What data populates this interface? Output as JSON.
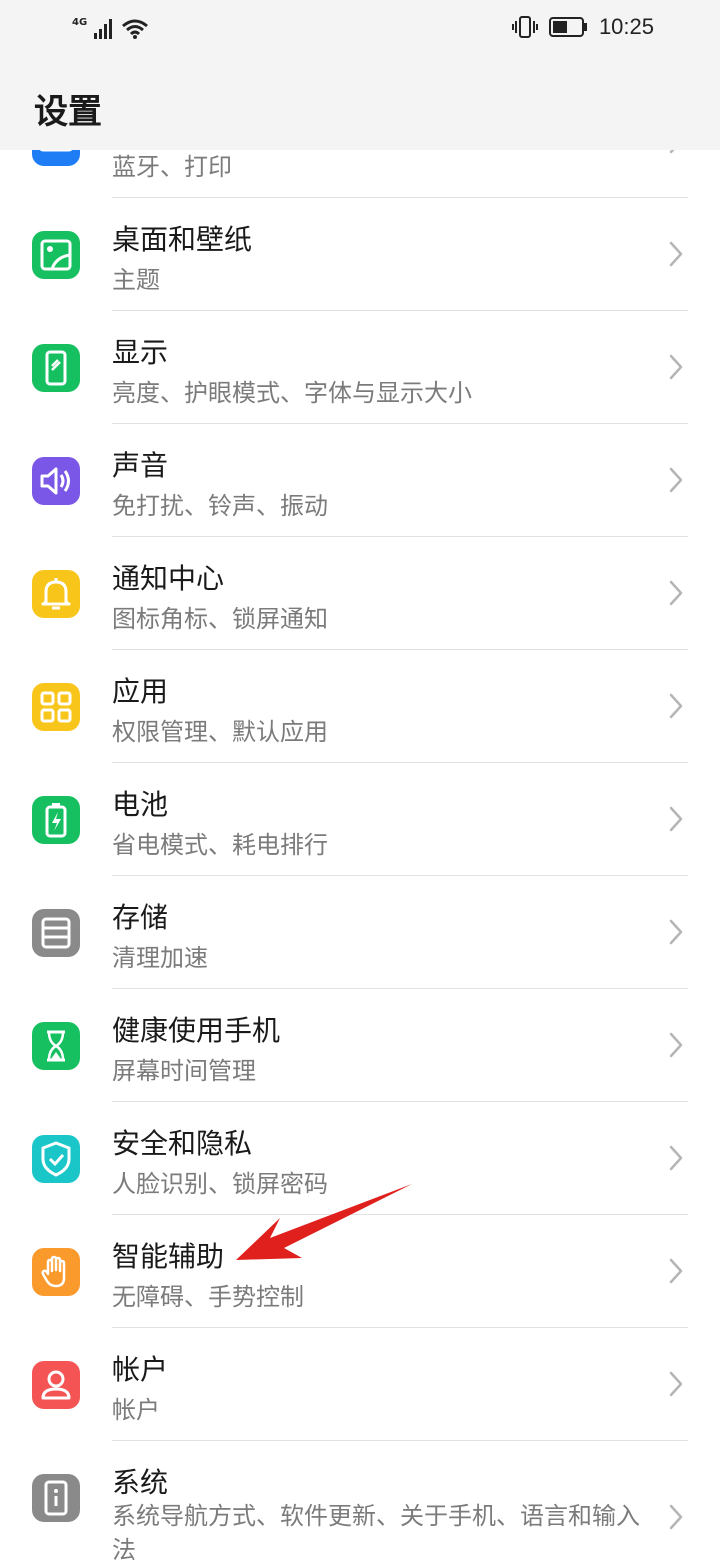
{
  "status_bar": {
    "network": "4G",
    "time": "10:25"
  },
  "header": {
    "title": "设置"
  },
  "items": [
    {
      "title": "",
      "subtitle": "蓝牙、打印",
      "icon": "device-connection-icon",
      "color": "#1e7cf5"
    },
    {
      "title": "桌面和壁纸",
      "subtitle": "主题",
      "icon": "wallpaper-icon",
      "color": "#16c060"
    },
    {
      "title": "显示",
      "subtitle": "亮度、护眼模式、字体与显示大小",
      "icon": "display-icon",
      "color": "#16c060"
    },
    {
      "title": "声音",
      "subtitle": "免打扰、铃声、振动",
      "icon": "sound-icon",
      "color": "#7a57e6"
    },
    {
      "title": "通知中心",
      "subtitle": "图标角标、锁屏通知",
      "icon": "bell-icon",
      "color": "#f8c61b"
    },
    {
      "title": "应用",
      "subtitle": "权限管理、默认应用",
      "icon": "apps-icon",
      "color": "#f8c61b"
    },
    {
      "title": "电池",
      "subtitle": "省电模式、耗电排行",
      "icon": "battery-icon",
      "color": "#16c060"
    },
    {
      "title": "存储",
      "subtitle": "清理加速",
      "icon": "storage-icon",
      "color": "#8a8a8a"
    },
    {
      "title": "健康使用手机",
      "subtitle": "屏幕时间管理",
      "icon": "hourglass-icon",
      "color": "#16c060"
    },
    {
      "title": "安全和隐私",
      "subtitle": "人脸识别、锁屏密码",
      "icon": "shield-check-icon",
      "color": "#1bc6c8"
    },
    {
      "title": "智能辅助",
      "subtitle": "无障碍、手势控制",
      "icon": "hand-icon",
      "color": "#fa9a2c"
    },
    {
      "title": "帐户",
      "subtitle": "帐户",
      "icon": "account-icon",
      "color": "#f55454"
    },
    {
      "title": "系统",
      "subtitle": "系统导航方式、软件更新、关于手机、语言和输入法",
      "icon": "system-info-icon",
      "color": "#8a8a8a"
    }
  ],
  "annotation": {
    "color": "#e0201d",
    "target_item": "智能辅助"
  }
}
